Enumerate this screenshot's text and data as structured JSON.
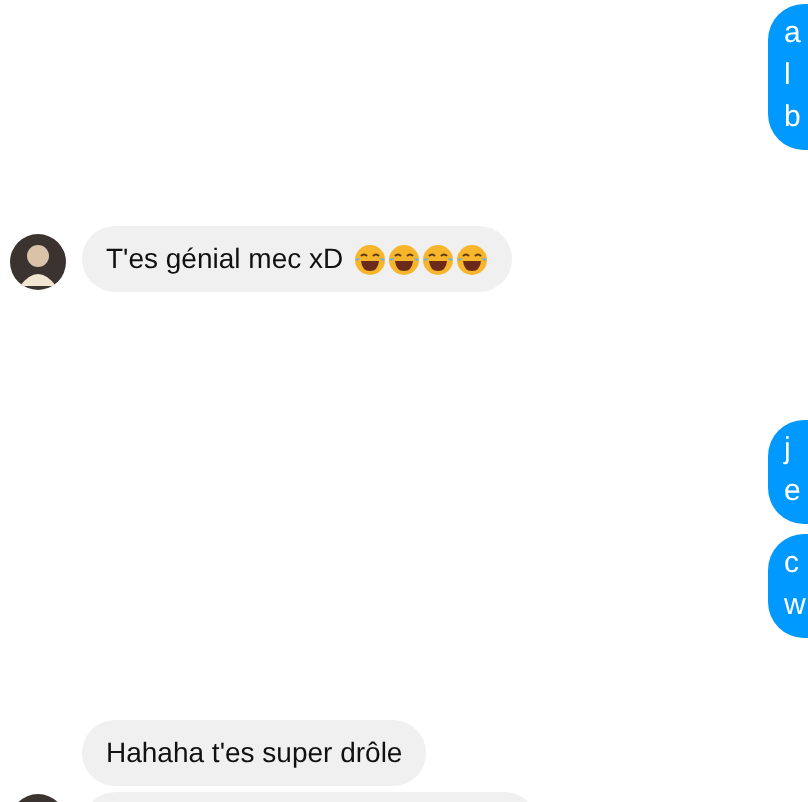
{
  "messages": [
    {
      "kind": "sent",
      "lines": [
        "a",
        "l",
        "b"
      ]
    },
    {
      "kind": "received",
      "avatar": true,
      "lines": [
        "T'es génial mec xD"
      ],
      "trailing_icons": [
        {
          "kind": "laughing"
        },
        {
          "kind": "laughing"
        },
        {
          "kind": "laughing"
        },
        {
          "kind": "laughing"
        }
      ]
    },
    {
      "kind": "sent",
      "lines": [
        "j",
        "e"
      ]
    },
    {
      "kind": "sent",
      "lines": [
        "c",
        "w"
      ]
    },
    {
      "kind": "received",
      "avatar": false,
      "lines": [
        "Hahaha t'es super drôle"
      ]
    },
    {
      "kind": "received",
      "avatar": true
    }
  ]
}
